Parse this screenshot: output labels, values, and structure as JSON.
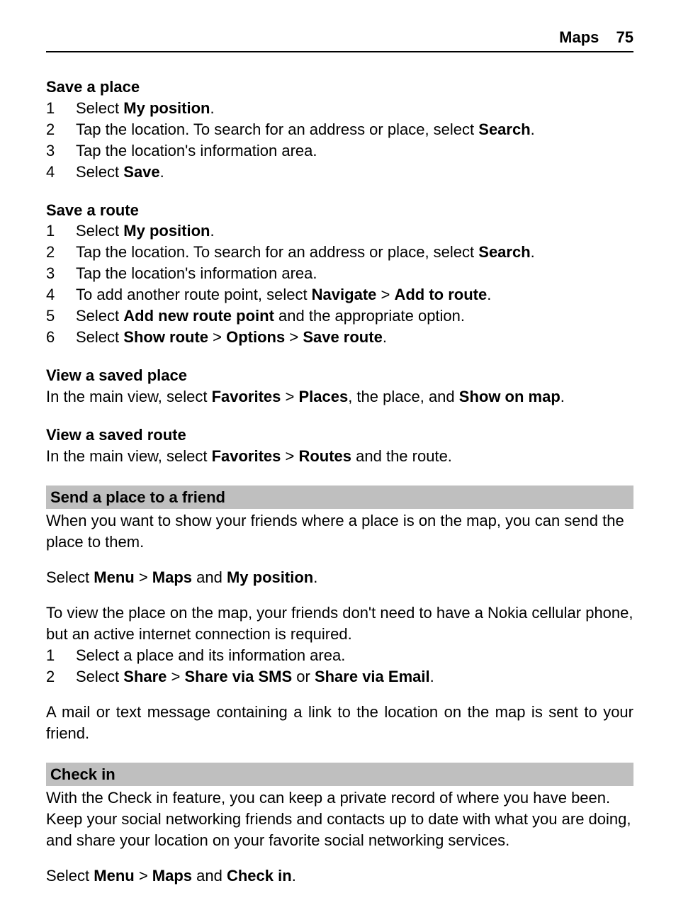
{
  "header": {
    "title": "Maps",
    "page_number": "75"
  },
  "save_place": {
    "title": "Save a place",
    "steps": [
      {
        "pre": "Select ",
        "b1": "My position",
        "post": "."
      },
      {
        "pre": "Tap the location. To search for an address or place, select ",
        "b1": "Search",
        "post": "."
      },
      {
        "pre": "Tap the location's information area."
      },
      {
        "pre": "Select ",
        "b1": "Save",
        "post": "."
      }
    ]
  },
  "save_route": {
    "title": "Save a route",
    "steps": [
      {
        "pre": "Select ",
        "b1": "My position",
        "post": "."
      },
      {
        "pre": "Tap the location. To search for an address or place, select ",
        "b1": "Search",
        "post": "."
      },
      {
        "pre": "Tap the location's information area."
      },
      {
        "pre": "To add another route point, select ",
        "b1": "Navigate",
        "mid1": " > ",
        "b2": "Add to route",
        "post": "."
      },
      {
        "pre": "Select ",
        "b1": "Add new route point",
        "post": " and the appropriate option."
      },
      {
        "pre": "Select ",
        "b1": "Show route",
        "mid1": " > ",
        "b2": "Options",
        "mid2": " > ",
        "b3": "Save route",
        "post": "."
      }
    ]
  },
  "view_place": {
    "title": "View a saved place",
    "pre": "In the main view, select ",
    "b1": "Favorites",
    "m1": " > ",
    "b2": "Places",
    "mid": ", the place, and ",
    "b3": "Show on map",
    "post": "."
  },
  "view_route": {
    "title": "View a saved route",
    "pre": "In the main view, select ",
    "b1": "Favorites",
    "m1": " > ",
    "b2": "Routes",
    "post": " and the route."
  },
  "send_friend": {
    "title": "Send a place to a friend",
    "intro": "When you want to show your friends where a place is on the map, you can send the place to them.",
    "nav_pre": "Select ",
    "nav_b1": "Menu",
    "nav_m1": " > ",
    "nav_b2": "Maps",
    "nav_mid": " and ",
    "nav_b3": "My position",
    "nav_post": ".",
    "note": "To view the place on the map, your friends don't need to have a Nokia cellular phone, but an active internet connection is required.",
    "steps": [
      {
        "pre": "Select a place and its information area."
      },
      {
        "pre": "Select ",
        "b1": "Share",
        "mid1": " > ",
        "b2": "Share via SMS",
        "mid2": " or ",
        "b3": "Share via Email",
        "post": "."
      }
    ],
    "outro": "A mail or text message containing a link to the location on the map is sent to your friend."
  },
  "check_in": {
    "title": "Check in",
    "intro": "With the Check in feature, you can keep a private record of where you have been. Keep your social networking friends and contacts up to date with what you are doing, and share your location on your favorite social networking services.",
    "nav_pre": "Select ",
    "nav_b1": "Menu",
    "nav_m1": " > ",
    "nav_b2": "Maps",
    "nav_mid": " and ",
    "nav_b3": "Check in",
    "nav_post": "."
  }
}
